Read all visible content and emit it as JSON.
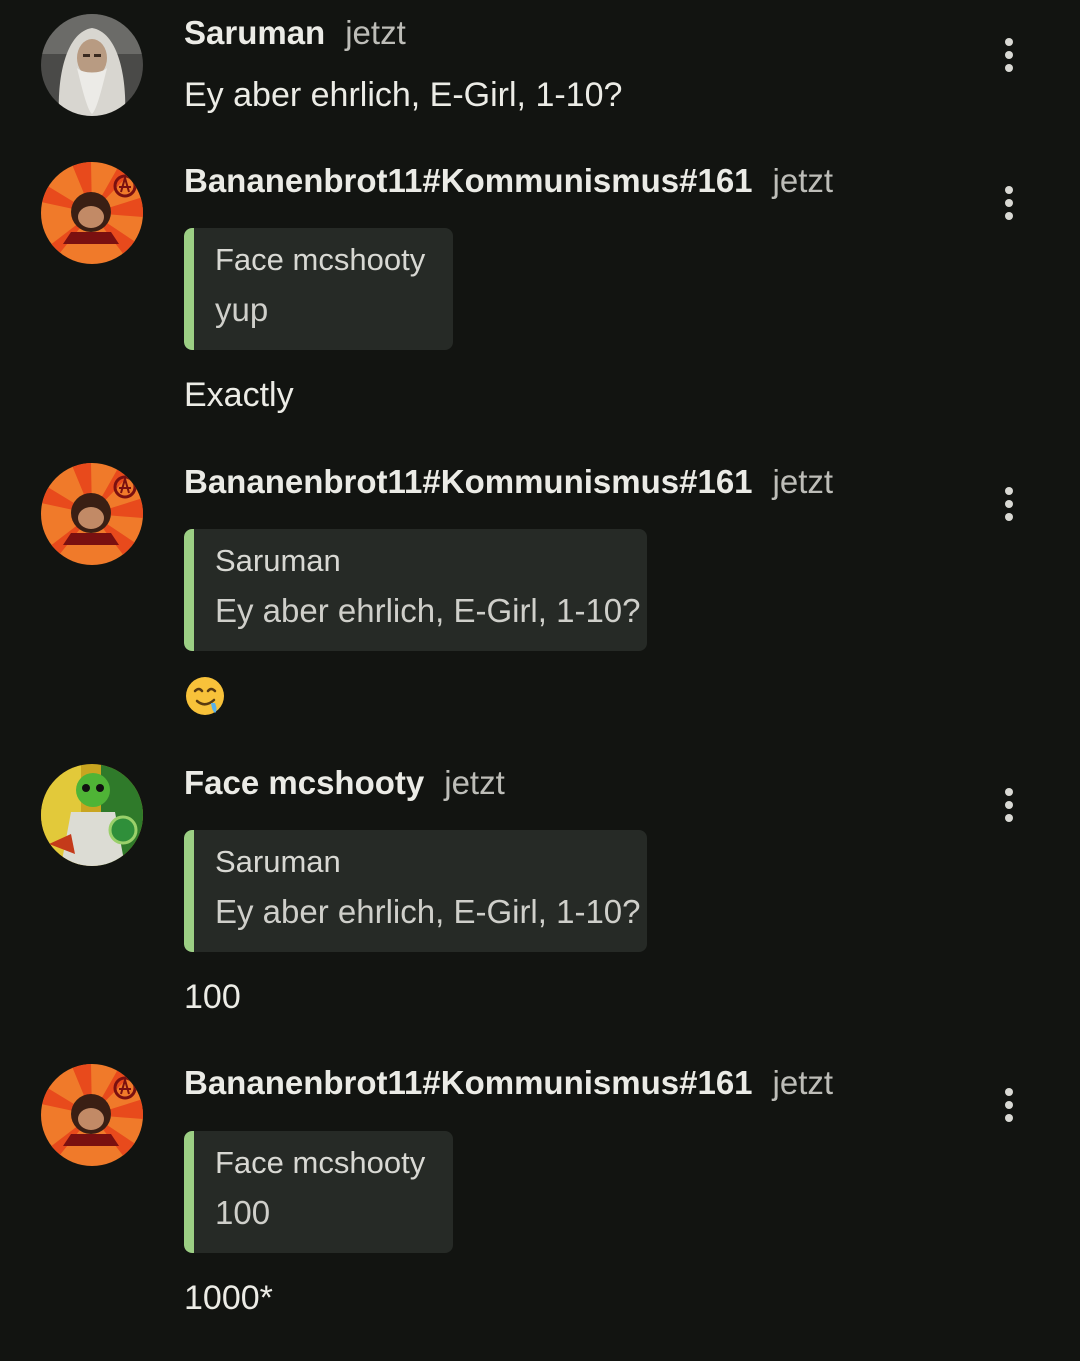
{
  "messages": [
    {
      "author": "Saruman",
      "time": "jetzt",
      "text": "Ey aber ehrlich, E-Girl, 1-10?"
    },
    {
      "author": "Bananenbrot11#Kommunismus#161",
      "time": "jetzt",
      "quote": {
        "author": "Face mcshooty",
        "text": "yup"
      },
      "text": "Exactly"
    },
    {
      "author": "Bananenbrot11#Kommunismus#161",
      "time": "jetzt",
      "quote": {
        "author": "Saruman",
        "text": "Ey aber ehrlich, E-Girl, 1-10?"
      },
      "emoji": "drooling-face"
    },
    {
      "author": "Face mcshooty",
      "time": "jetzt",
      "quote": {
        "author": "Saruman",
        "text": "Ey aber ehrlich, E-Girl, 1-10?"
      },
      "text": "100"
    },
    {
      "author": "Bananenbrot11#Kommunismus#161",
      "time": "jetzt",
      "quote": {
        "author": "Face mcshooty",
        "text": "100"
      },
      "text": "1000*"
    }
  ],
  "colors": {
    "background": "#121411",
    "quote_background": "#262a26",
    "quote_accent": "#9ccf84"
  }
}
